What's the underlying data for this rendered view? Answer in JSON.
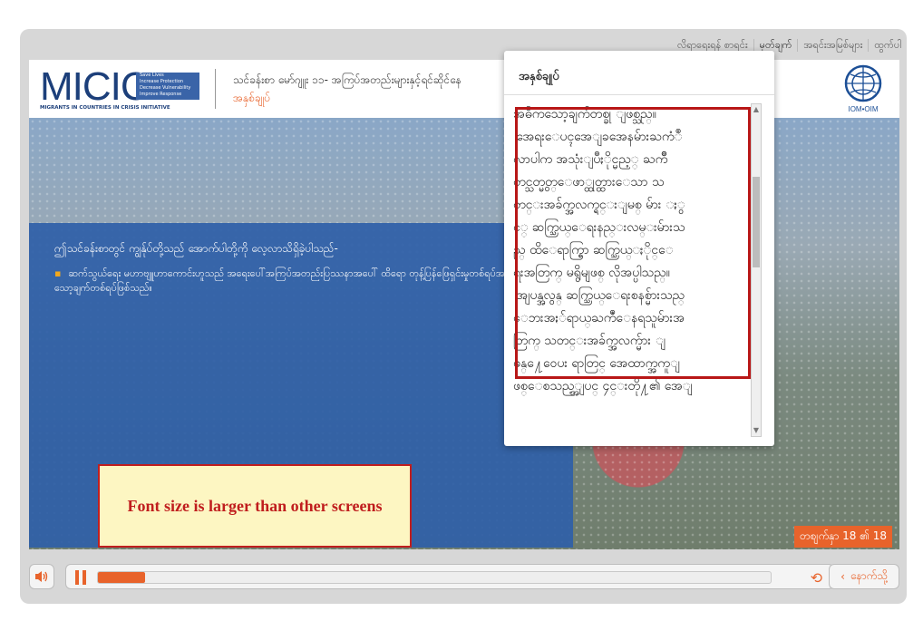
{
  "topnav": {
    "items": [
      "လိရာရေးရန် စာရင်း",
      "မှတ်ချက်",
      "အရင်းအမြစ်များ",
      "ထွက်ပါ"
    ]
  },
  "header": {
    "logo_text": "MICIC",
    "logo_tagline": [
      "Save Lives",
      "Increase Protection",
      "Decrease Vulnerability",
      "Improve Response"
    ],
    "logo_subtitle": "MIGRANTS IN COUNTRIES IN CRISIS INITIATIVE",
    "title": "သင်ခန်းစာ မော်ဂျူး ၁၁- အကြပ်အတည်းများနှင့်ရင်ဆိုင်နေ",
    "subtitle": "အနှစ်ချုပ်",
    "iom_label": "IOM•OIM"
  },
  "slide": {
    "intro": "ဤသင်ခန်းစာတွင် ကျွန်ုပ်တို့သည် အောက်ပါတို့ကို လေ့လာသိရှိခဲ့ပါသည်-",
    "bullet": "ဆက်သွယ်ရေး မဟာဗျူဟာကောင်းဟူသည် အရေးပေါ်အကြပ်အတည်းပြဿနာအပေါ် ထိရော တုန့်ပြန်ဖြေရှင်းမှုတစ်ရပ်အတွက် အဓိကသော့ချက်တစ်ရပ်ဖြစ်သည်။",
    "note": "Font size is larger than other screens",
    "slide_counter": "တစျက်နှာ 18 ၏ 18"
  },
  "popup": {
    "title": "အနှစ်ချုပ်",
    "lines": [
      {
        "text": "အဓိကသော့ချက်တစ္ခု ျဖစ္သည္။",
        "bullet": false
      },
      {
        "text": "အေရးေပၚအေျခအေနမ်ားႀကံဳ",
        "bullet": true
      },
      {
        "text": "လာပါက အသုံးျပဳႏိုင္မည့္ ႀကိဳ",
        "bullet": false
      },
      {
        "text": "တင္သတ္မွတ္ေဖာ္ထုတ္ထားေသာ သ",
        "bullet": false
      },
      {
        "text": "တင္းအခ်က္အလက္ရင္းျမစ္ မ်ား ႏွ",
        "bullet": false
      },
      {
        "text": "င့္ ဆက္သြယ္ေရးနည္းလမ္းမ်ားသ",
        "bullet": false
      },
      {
        "text": "ည္ ထိေရာက္စြာ ဆက္သြယ္ႏိုင္ေ",
        "bullet": false
      },
      {
        "text": "ရးအတြက္ မရွိမျဖစ္ လိုအပ္ပါသည္။",
        "bullet": false
      },
      {
        "text": "အျပန္အလွန္ ဆက္သြယ္ေရးစနစ္မ်ားသည္",
        "bullet": true
      },
      {
        "text": "ေဘးအႏၲရာယ္ႀကဳံေနရသူမ်ားအ",
        "bullet": false
      },
      {
        "text": "တြက္ သတင္းအခ်က္အလက္မ်ား ျ",
        "bullet": false
      },
      {
        "text": "ဖန္႔ေဝေပး ရာတြင္ အေထာက္အကူျ",
        "bullet": false
      },
      {
        "text": "ဖစ္ေစသည့္အျပင္ ၄င္းတို႔၏ အေျ",
        "bullet": false
      }
    ]
  },
  "controls": {
    "back_label": "နောက်သို့",
    "progress": 0.07
  },
  "colors": {
    "accent": "#e8632b",
    "panel_blue": "#2f60a8",
    "note_red": "#c01e1e",
    "note_bg": "#fdf6c2"
  }
}
